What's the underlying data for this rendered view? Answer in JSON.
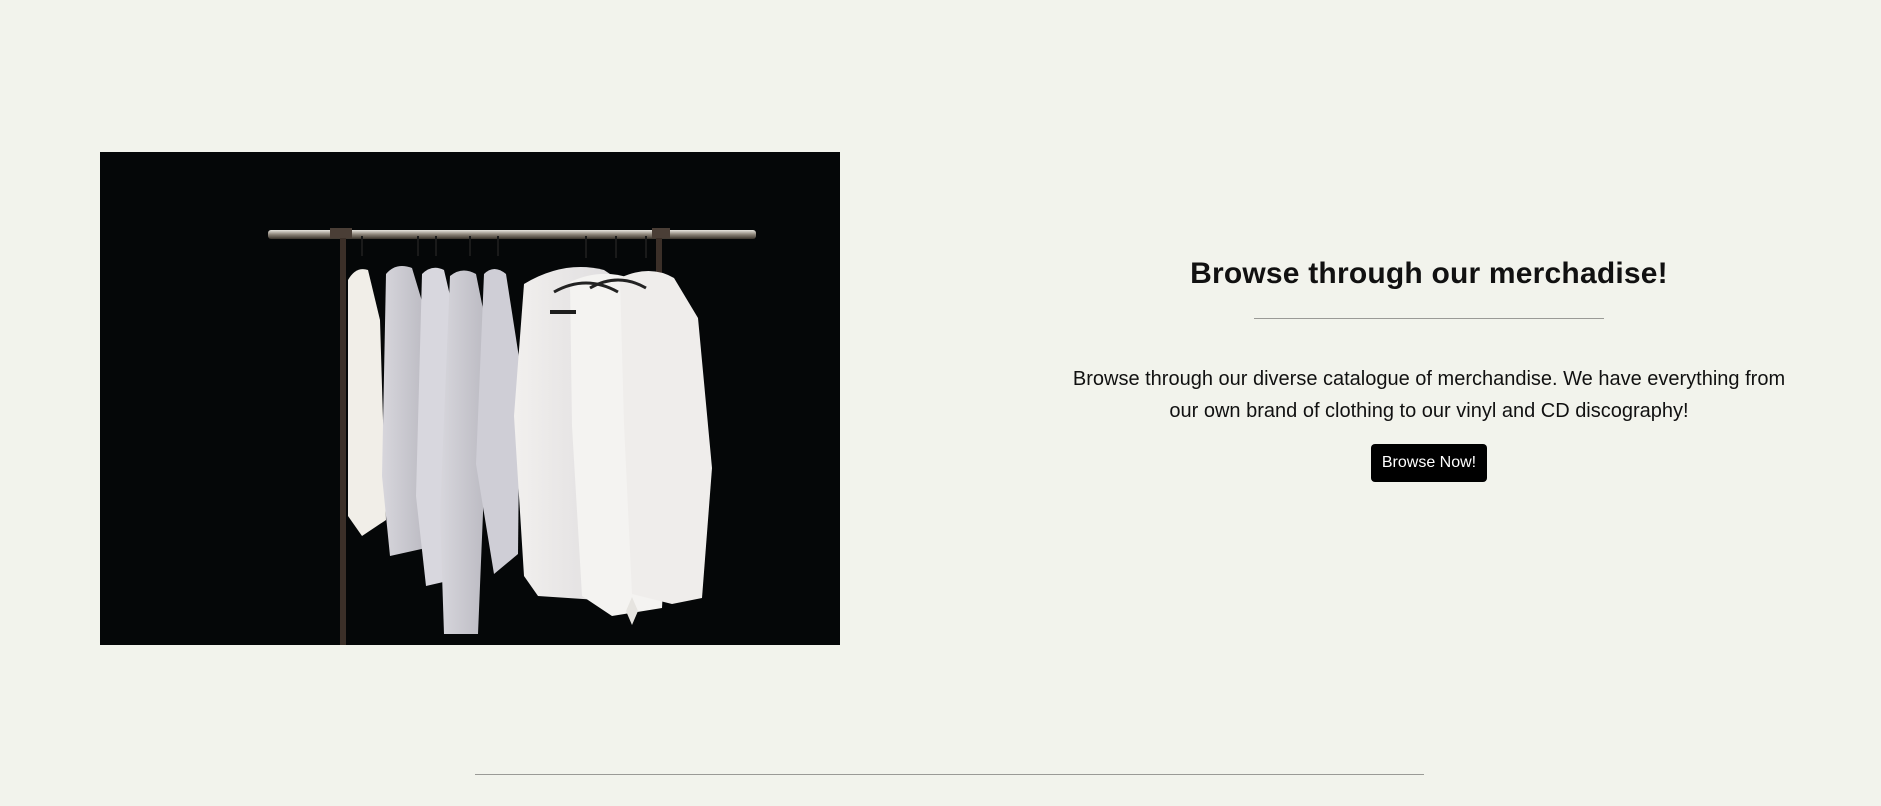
{
  "promo": {
    "image_alt": "Clothing rack with white garments",
    "title": "Browse through our merchadise!",
    "description": "Browse through our diverse catalogue of merchandise. We have everything from our own brand of clothing to our vinyl and CD discography!",
    "cta_label": "Browse Now!"
  },
  "colors": {
    "background": "#f2f3ec",
    "button": "#000000",
    "divider": "#9a9a96"
  }
}
